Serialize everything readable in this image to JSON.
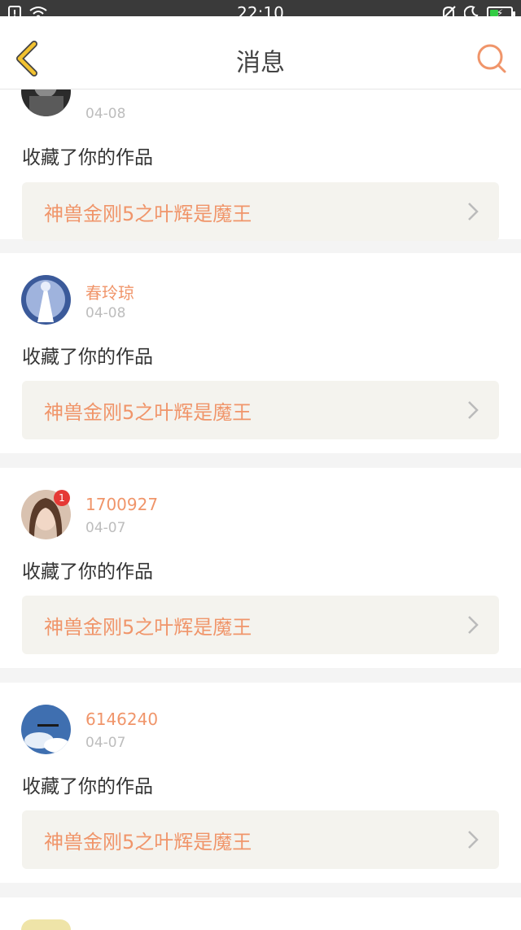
{
  "status_bar": {
    "time": "22:10"
  },
  "header": {
    "title": "消息"
  },
  "messages": [
    {
      "username": "",
      "date": "04-08",
      "action": "收藏了你的作品",
      "work_title": "神兽金刚5之叶辉是魔王"
    },
    {
      "username": "春玲琼",
      "date": "04-08",
      "action": "收藏了你的作品",
      "work_title": "神兽金刚5之叶辉是魔王"
    },
    {
      "username": "1700927",
      "date": "04-07",
      "action": "收藏了你的作品",
      "work_title": "神兽金刚5之叶辉是魔王",
      "badge": "1"
    },
    {
      "username": "6146240",
      "date": "04-07",
      "action": "收藏了你的作品",
      "work_title": "神兽金刚5之叶辉是魔王"
    }
  ],
  "icons": {
    "back": "chevron-left-icon",
    "search": "search-icon",
    "row_arrow": "chevron-right-icon"
  },
  "colors": {
    "accent": "#f0956a",
    "back_icon": "#f2c230",
    "work_box": "#f4f3ee",
    "status_bar": "#3a3a3a"
  }
}
